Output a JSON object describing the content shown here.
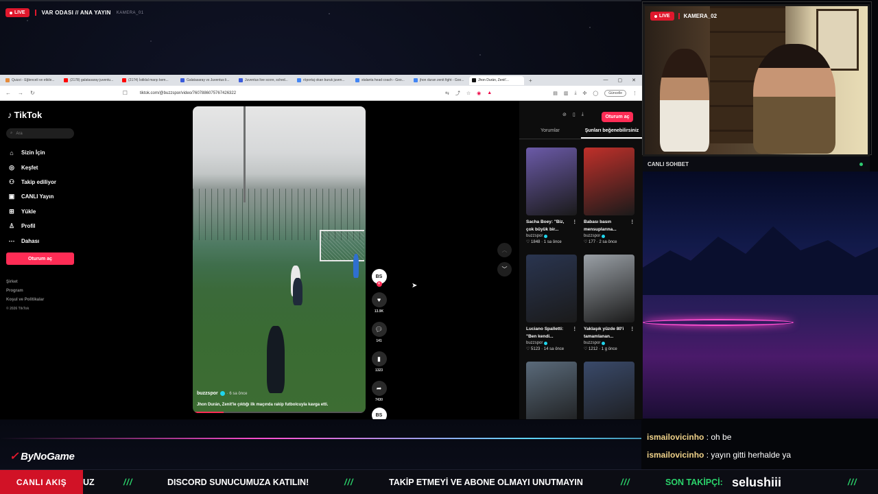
{
  "stream": {
    "live_badge": "LIVE",
    "title": "VAR ODASI // ANA YAYIN",
    "camera1_label": "KAMERA_01",
    "camera2_label": "KAMERA_02"
  },
  "browser": {
    "tabs": [
      {
        "label": "Quizzi - Eğlenceli ve etkile...",
        "color": "#e58a3a"
      },
      {
        "label": "(2178) galatasaray juventu...",
        "color": "#ff0000"
      },
      {
        "label": "(2174) İstiklal marşı kem...",
        "color": "#ff0000"
      },
      {
        "label": "Galatasaray vs Juventus li...",
        "color": "#3b5bdb"
      },
      {
        "label": "Juventus live score, sched...",
        "color": "#3b5bdb"
      },
      {
        "label": "röportaj okan buruk juven...",
        "color": "#4285f4"
      },
      {
        "label": "stalanta head coach - Goo...",
        "color": "#4285f4"
      },
      {
        "label": "jhon duran zenit fight - Goo...",
        "color": "#4285f4"
      },
      {
        "label": "Jhon Durán, Zenit'...",
        "color": "#111111",
        "active": true
      }
    ],
    "url": "tiktok.com/@buzzspor/video/7607886075767426322",
    "update_label": "Güncelle"
  },
  "tiktok": {
    "brand": "TikTok",
    "search_placeholder": "Ara",
    "nav": [
      {
        "label": "Sizin İçin",
        "icon": "home-icon",
        "glyph": "⌂"
      },
      {
        "label": "Keşfet",
        "icon": "compass-icon",
        "glyph": "◎"
      },
      {
        "label": "Takip ediliyor",
        "icon": "following-icon",
        "glyph": "⚇"
      },
      {
        "label": "CANLI Yayın",
        "icon": "live-icon",
        "glyph": "▣"
      },
      {
        "label": "Yükle",
        "icon": "upload-icon",
        "glyph": "⊞"
      },
      {
        "label": "Profil",
        "icon": "profile-icon",
        "glyph": "♙"
      },
      {
        "label": "Dahası",
        "icon": "more-icon",
        "glyph": "⋯"
      }
    ],
    "login_label": "Oturum aç",
    "footer": [
      "Şirket",
      "Program",
      "Koşul ve Politikalar"
    ],
    "copyright": "© 2026 TikTok",
    "video": {
      "author": "buzzspor",
      "time": "· 6 sa önce",
      "description": "Jhon Durán, Zenit'le çıktığı ilk maçında rakip futbolcuyla kavga etti.",
      "progress": 0.18
    },
    "actions": {
      "likes": "13.9K",
      "comments": "141",
      "saves": "1323",
      "shares": "7430"
    },
    "right": {
      "login_label": "Oturum aç",
      "tabs": [
        "Yorumlar",
        "Şunları beğenebilirsiniz"
      ],
      "cards": [
        {
          "title": "Sacha Boey: \"Biz, çok büyük bir...",
          "author": "buzzspor",
          "likes": "♡ 1848",
          "time": "1 sa önce",
          "bg": "#6b5aa8"
        },
        {
          "title": "Babası basın mensuplarına...",
          "author": "buzzspor",
          "likes": "♡ 177",
          "time": "2 sa önce",
          "bg": "#c0302a"
        },
        {
          "title": "Luciano Spalletti: \"Ben kendi...",
          "author": "buzzspor",
          "likes": "♡ 5123",
          "time": "14 sa önce",
          "bg": "#2a3550"
        },
        {
          "title": "Yaklaşık yüzde 80'i tamamlanan...",
          "author": "buzzspor",
          "likes": "♡ 1212",
          "time": "1 g önce",
          "bg": "#9aa0a6"
        },
        {
          "title": "",
          "author": "",
          "likes": "",
          "time": "",
          "bg": "#5a6a7a"
        },
        {
          "title": "",
          "author": "",
          "likes": "",
          "time": "",
          "bg": "#3a4a6a"
        }
      ]
    }
  },
  "chat": {
    "header": "CANLI SOHBET",
    "messages": [
      {
        "user": "ismailovicinho",
        "text": ": oh be"
      },
      {
        "user": "ismailovicinho",
        "text": ": yayın gitti herhalde ya"
      }
    ]
  },
  "overlay": {
    "brand": "ByNoGame",
    "ticker_capsule": "CANLI AKIŞ",
    "ticker_fragment": "UZ",
    "ticker_sep": "///",
    "ticker_msg1": "DISCORD SUNUCUMUZA KATILIN!",
    "ticker_msg2": "TAKİP ETMEYİ VE ABONE OLMAYI UNUTMAYIN",
    "last_follower_label": "SON TAKİPÇİ:",
    "last_follower": "selushiii"
  },
  "colors": {
    "accent": "#fe2c55",
    "live": "#e0182d",
    "ticker_green": "#2bd36b"
  }
}
